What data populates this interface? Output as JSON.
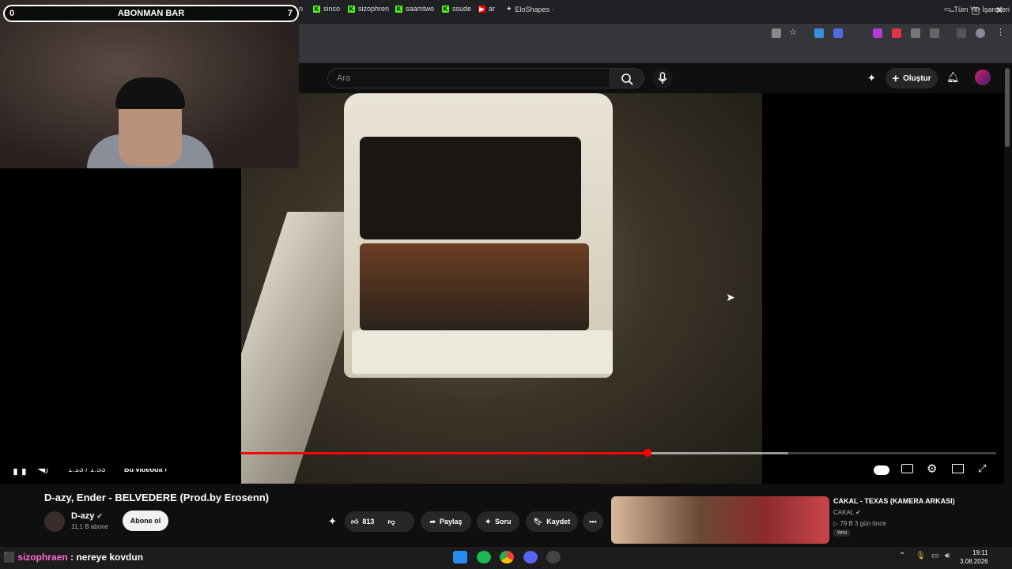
{
  "overlay": {
    "bar_title": "ABONMAN BAR",
    "bar_left": "0",
    "bar_right": "7"
  },
  "bookmarks": {
    "items": [
      {
        "label": "sinco",
        "icon": "kick-icon"
      },
      {
        "label": "sizophren",
        "icon": "kick-icon"
      },
      {
        "label": "saamtwo",
        "icon": "kick-icon"
      },
      {
        "label": "ssude",
        "icon": "kick-icon"
      },
      {
        "label": "ar",
        "icon": "youtube-icon"
      },
      {
        "label": "EloShapes ·",
        "icon": "eloshapes-icon"
      }
    ],
    "partial": "n",
    "all_bookmarks": "Tüm Yer İşaretleri"
  },
  "youtube": {
    "search_placeholder": "Ara",
    "create_label": "Oluştur"
  },
  "player": {
    "time": "1:13 / 1:53",
    "chapter": "Bu videoda",
    "progress_fraction": 0.648,
    "buffered_fraction": 0.79
  },
  "video": {
    "title": "D-azy, Ender - BELVEDERE (Prod.by Erosenn)",
    "channel": "D-azy",
    "subscribers": "11,1 B abone",
    "subscribe_label": "Abone ol",
    "likes": "813",
    "share_label": "Paylaş",
    "ask_label": "Soru",
    "save_label": "Kaydet"
  },
  "recommended": {
    "title": "CAKAL - TEXAS (KAMERA ARKASI)",
    "channel": "CAKAL",
    "meta": "▷ 79 B   3 gün önce",
    "badge": "Yeni"
  },
  "chat": {
    "user": "sizophraen",
    "message": " : nereye kovdun"
  },
  "clock": {
    "time": "19:11",
    "date": "3.08.2026"
  },
  "colors": {
    "accent": "#ff0000",
    "kick": "#53fc18",
    "bg": "#0f0f0f"
  }
}
